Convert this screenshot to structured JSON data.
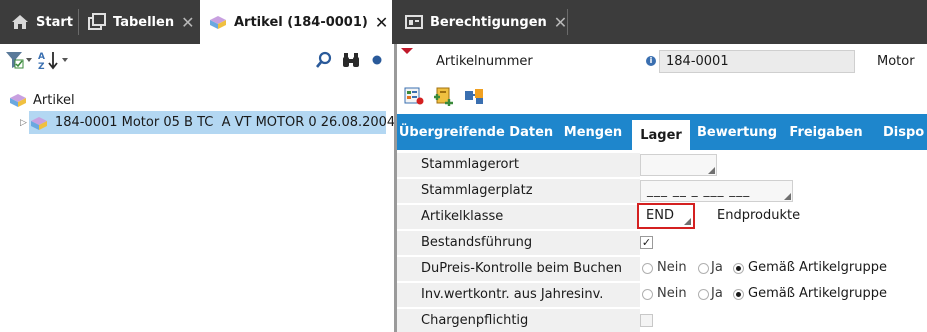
{
  "tabs": [
    {
      "label": "Start",
      "icon": "home-icon"
    },
    {
      "label": "Tabellen",
      "icon": "tables-icon",
      "close": "✕"
    },
    {
      "label": "Artikel (184-0001)",
      "icon": "article-icon",
      "close": "✕",
      "active": true
    },
    {
      "label": "Berechtigungen",
      "icon": "permissions-icon",
      "close": "✕"
    }
  ],
  "left_toolbar": {
    "icons": [
      "filter-icon",
      "sort-az-icon",
      "search-icon",
      "binoculars-icon",
      "dot-icon"
    ]
  },
  "tree": {
    "root_label": "Artikel",
    "expander": "▷",
    "child_label": "184-0001 Motor 05 B TC  A VT MOTOR 0 26.08.2004"
  },
  "header": {
    "label": "Artikelnummer",
    "info_glyph": "i",
    "value": "184-0001",
    "description": "Motor"
  },
  "action_icons": [
    "article-list-icon",
    "add-article-icon",
    "transfer-icon"
  ],
  "detail_tabs": [
    {
      "label": "Übergreifende Daten"
    },
    {
      "label": "Mengen"
    },
    {
      "label": "Lager",
      "active": true
    },
    {
      "label": "Bewertung"
    },
    {
      "label": "Freigaben"
    },
    {
      "label": "Dispo"
    }
  ],
  "form": {
    "stammlagerort": {
      "label": "Stammlagerort",
      "value": ""
    },
    "stammlagerplatz": {
      "label": "Stammlagerplatz",
      "value": "___ __ _ ___ ___"
    },
    "artikelklasse": {
      "label": "Artikelklasse",
      "value": "END",
      "description": "Endprodukte"
    },
    "bestandsfuehrung": {
      "label": "Bestandsführung",
      "checked": true,
      "check_glyph": "✓"
    },
    "dupreis": {
      "label": "DuPreis-Kontrolle beim Buchen",
      "options": [
        "Nein",
        "Ja",
        "Gemäß Artikelgruppe"
      ],
      "selected": "Gemäß Artikelgruppe"
    },
    "invwert": {
      "label": "Inv.wertkontr. aus Jahresinv.",
      "options": [
        "Nein",
        "Ja",
        "Gemäß Artikelgruppe"
      ],
      "selected": "Gemäß Artikelgruppe"
    },
    "chargen": {
      "label": "Chargenpflichtig",
      "checked": false
    }
  },
  "colors": {
    "tabbar": "#3c3c3c",
    "accent": "#1e86cc",
    "selection": "#b3d7f2",
    "error_outline": "#d42020"
  }
}
